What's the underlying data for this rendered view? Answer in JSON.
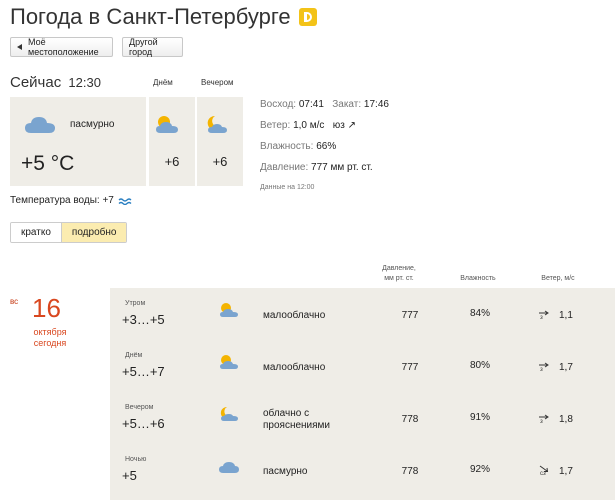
{
  "header": {
    "title": "Погода в Санкт-Петербурге",
    "badge_icon": "yandex-weather-logo"
  },
  "buttons": {
    "my_location": "Моё местоположение",
    "other_city": "Другой город"
  },
  "now": {
    "label": "Сейчас",
    "time": "12:30",
    "condition": "пасмурно",
    "temperature": "+5 °C",
    "icon": "cloud-icon"
  },
  "columns": {
    "day": "Днём",
    "evening": "Вечером"
  },
  "short_forecast": {
    "day": {
      "temperature": "+6",
      "icon": "partly-cloudy-icon"
    },
    "evening": {
      "temperature": "+6",
      "icon": "moon-cloud-icon"
    }
  },
  "details": {
    "sunrise_label": "Восход:",
    "sunrise": "07:41",
    "sunset_label": "Закат:",
    "sunset": "17:46",
    "wind_label": "Ветер:",
    "wind": "1,0 м/с",
    "wind_dir": "юз",
    "humidity_label": "Влажность:",
    "humidity": "66%",
    "pressure_label": "Давление:",
    "pressure": "777 мм рт. ст.",
    "updated": "Данные на 12:00"
  },
  "water": {
    "label": "Температура воды:",
    "value": "+7"
  },
  "tabs": {
    "brief": "кратко",
    "detailed": "подробно",
    "active": "detailed"
  },
  "forecast_headers": {
    "pressure_line1": "Давление,",
    "pressure_line2": "мм рт. ст.",
    "humidity": "Влажность",
    "wind": "Ветер, м/с"
  },
  "day": {
    "dow": "вс",
    "number": "16",
    "month": "октября",
    "today": "сегодня"
  },
  "forecast_rows": [
    {
      "part": "Утром",
      "temp": "+3…+5",
      "icon": "partly-cloudy-icon",
      "cond1": "малооблачно",
      "cond2": "",
      "pressure": "777",
      "humidity": "84%",
      "wind_dir": "з",
      "wind_arrow": "east-arrow-icon",
      "wind": "1,1"
    },
    {
      "part": "Днём",
      "temp": "+5…+7",
      "icon": "partly-cloudy-icon",
      "cond1": "малооблачно",
      "cond2": "",
      "pressure": "777",
      "humidity": "80%",
      "wind_dir": "з",
      "wind_arrow": "east-arrow-icon",
      "wind": "1,7"
    },
    {
      "part": "Вечером",
      "temp": "+5…+6",
      "icon": "moon-cloud-icon",
      "cond1": "облачно с",
      "cond2": "прояснениями",
      "pressure": "778",
      "humidity": "91%",
      "wind_dir": "з",
      "wind_arrow": "east-arrow-icon",
      "wind": "1,8"
    },
    {
      "part": "Ночью",
      "temp": "+5",
      "icon": "cloud-icon",
      "cond1": "пасмурно",
      "cond2": "",
      "pressure": "778",
      "humidity": "92%",
      "wind_dir": "сз",
      "wind_arrow": "southeast-arrow-icon",
      "wind": "1,7"
    }
  ],
  "colors": {
    "panel": "#efede7",
    "accent_red": "#d9471f",
    "tab_active": "#fbecb0",
    "cloud": "#7aa4cf",
    "sun": "#f4b400"
  }
}
